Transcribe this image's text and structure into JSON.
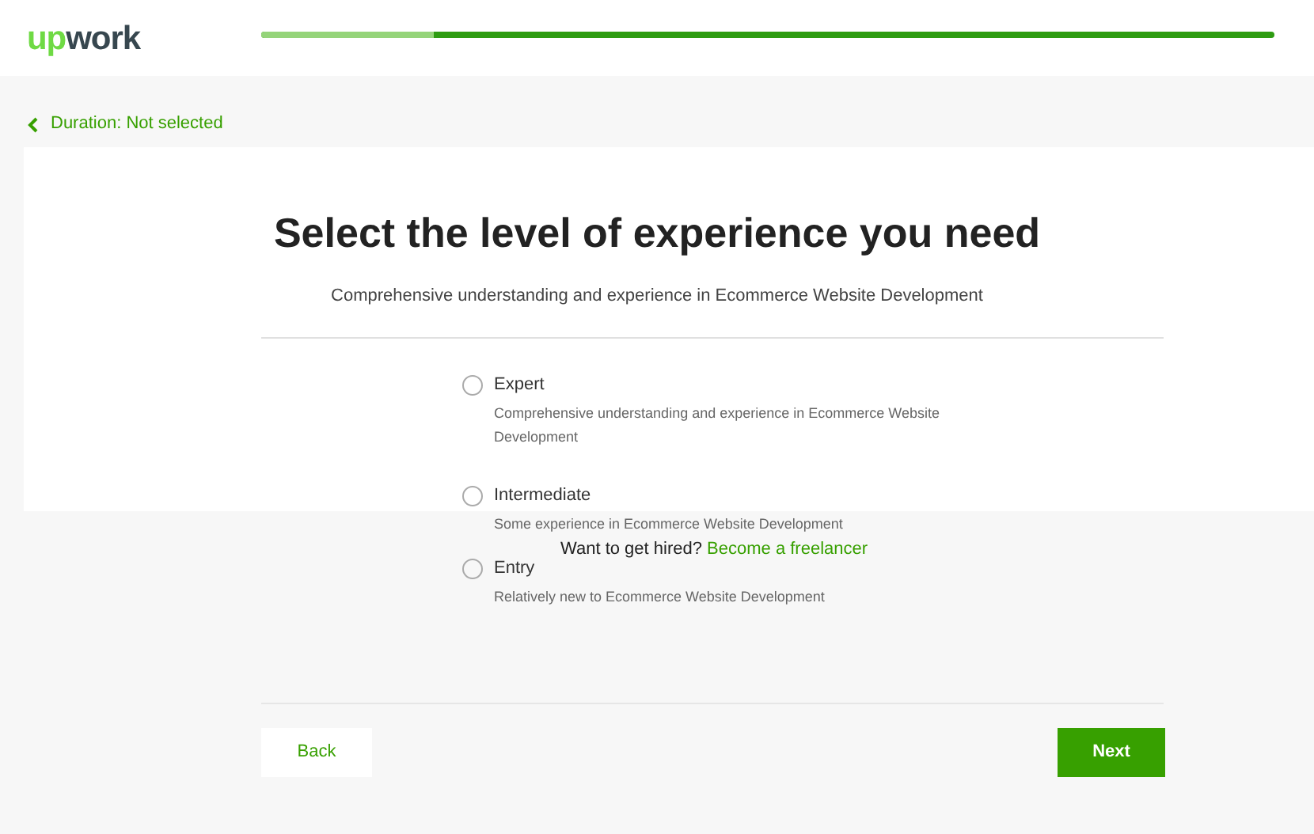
{
  "header": {
    "logo": "upwork",
    "progress": {
      "level": 0.17
    }
  },
  "back_link": "Duration: Not selected",
  "title": "Select the level of experience you need",
  "subtitle": "Comprehensive understanding and experience in Ecommerce Website Development",
  "options": [
    {
      "label": "Expert",
      "description": "Comprehensive understanding and experience in Ecommerce Website Development",
      "selected": false
    },
    {
      "label": "Intermediate",
      "description": "Some experience in Ecommerce Website Development",
      "selected": false
    },
    {
      "label": "Entry",
      "description": "Relatively new to Ecommerce Website Development",
      "selected": false
    }
  ],
  "hire_prompt": {
    "text": "Want to get hired?",
    "link": "Become a freelancer"
  },
  "buttons": {
    "back": "Back",
    "next": "Next"
  }
}
